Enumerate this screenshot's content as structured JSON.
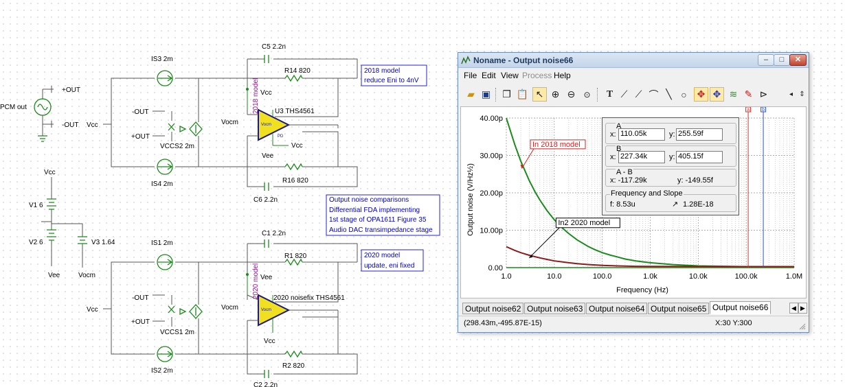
{
  "schematic": {
    "labels": {
      "pcm_out": "PCM out",
      "plus_out": "+OUT",
      "minus_out": "-OUT",
      "vcc": "Vcc",
      "vee": "Vee",
      "vocm": "Vocm",
      "v1": "V1 6",
      "v2": "V2 6",
      "v3": "V3 1.64",
      "is3": "IS3 2m",
      "is4": "IS4 2m",
      "is1": "IS1 2m",
      "is2": "IS2 2m",
      "vccs2": "VCCS2 2m",
      "vccs1": "VCCS1 2m",
      "c5": "C5 2.2n",
      "c6": "C6 2.2n",
      "c1": "C1 2.2n",
      "c2": "C2 2.2n",
      "r14": "R14 820",
      "r16": "R16 820",
      "r1": "R1 820",
      "r2": "R2 820",
      "u3": "U3 THS4561",
      "u3_vertical": "2018 model",
      "u1": "2020 noisefix THS4561",
      "u1_vertical": "2020 model",
      "amp_vocm": "Vocm",
      "amp_pd": "PD"
    },
    "note_2018": [
      "2018 model",
      "reduce Eni to 4nV"
    ],
    "note_main": [
      "Output noise comparisons",
      "Differential FDA implementing",
      "1st stage of OPA1611 Figure 35",
      "Audio DAC transimpedance stage"
    ],
    "note_2020": [
      "2020 model",
      "update, eni fixed"
    ]
  },
  "window": {
    "title": "Noname - Output noise66",
    "controls": {
      "minimize": "–",
      "maximize": "□",
      "close": "✕"
    },
    "menu": [
      {
        "label": "File",
        "disabled": false
      },
      {
        "label": "Edit",
        "disabled": false
      },
      {
        "label": "View",
        "disabled": false
      },
      {
        "label": "Process",
        "disabled": true
      },
      {
        "label": "Help",
        "disabled": false
      }
    ],
    "toolbar_icons": [
      "open-folder-icon",
      "save-icon",
      "copy-icon",
      "paste-icon",
      "pointer-icon",
      "zoom-in-icon",
      "zoom-out-icon",
      "zoom-100-icon",
      "text-tool-icon",
      "draw-icon-1",
      "draw-icon-2",
      "draw-icon-3",
      "line-tool-icon",
      "circle-tool-icon",
      "cursor-a-icon",
      "cursor-b-icon",
      "add-curve-icon",
      "marker-icon",
      "flag-icon",
      "scroll-left-icon",
      "scroll-up-down-icon"
    ],
    "cursor_panel": {
      "a_title": "A",
      "a_x_label": "x:",
      "a_x": "110.05k",
      "a_y_label": "y:",
      "a_y": "255.59f",
      "b_title": "B",
      "b_x_label": "x:",
      "b_x": "227.34k",
      "b_y_label": "y:",
      "b_y": "405.15f",
      "ab_title": "A - B",
      "ab_x": "x:  -117.29k",
      "ab_y": "y:  -149.55f",
      "freq_title": "Frequency and Slope",
      "freq_f": "f:  8.53u",
      "slope": "1.28E-18"
    },
    "tabs": [
      {
        "label": "Output noise62",
        "active": false
      },
      {
        "label": "Output noise63",
        "active": false
      },
      {
        "label": "Output noise64",
        "active": false
      },
      {
        "label": "Output noise65",
        "active": false
      },
      {
        "label": "Output noise66",
        "active": true
      }
    ],
    "status_left": "(298.43m,-495.87E-15)",
    "status_right": "X:30  Y:300"
  },
  "chart_data": {
    "type": "line",
    "title": "",
    "xlabel": "Frequency (Hz)",
    "ylabel": "Output noise (V/Hz½)",
    "x_scale": "log",
    "xlim": [
      1,
      1000000
    ],
    "ylim": [
      0,
      40
    ],
    "y_unit": "p",
    "x_ticks": [
      "1.0",
      "10.0",
      "100.0",
      "1.0k",
      "10.0k",
      "100.0k",
      "1.0M"
    ],
    "y_ticks": [
      "0.00",
      "10.00p",
      "20.00p",
      "30.00p",
      "40.00p"
    ],
    "grid": true,
    "series": [
      {
        "name": "",
        "color": "#1a8a1a",
        "x": [
          1,
          1.5,
          2,
          3,
          4,
          5,
          7,
          10,
          15,
          20,
          30,
          50,
          70,
          100,
          150,
          200,
          300,
          500,
          1000,
          3000,
          10000,
          100000,
          1000000
        ],
        "y": [
          40.0,
          32.9,
          28.5,
          23.3,
          20.2,
          18.1,
          15.3,
          12.8,
          10.5,
          9.1,
          7.4,
          5.7,
          4.8,
          4.0,
          3.3,
          2.9,
          2.3,
          1.8,
          1.3,
          0.8,
          0.45,
          0.26,
          0.26
        ]
      },
      {
        "name": "",
        "color": "#8b1a1a",
        "x": [
          1,
          1.5,
          2,
          3,
          5,
          7,
          10,
          15,
          20,
          30,
          50,
          100,
          200,
          500,
          1000,
          10000,
          100000,
          1000000
        ],
        "y": [
          5.6,
          4.6,
          4.0,
          3.3,
          2.6,
          2.2,
          1.8,
          1.5,
          1.3,
          1.05,
          0.82,
          0.6,
          0.45,
          0.35,
          0.32,
          0.3,
          0.28,
          0.28
        ]
      }
    ],
    "annotations": [
      {
        "text": "In 2018 model",
        "color": "#d62020"
      },
      {
        "text": "In2 2020 model",
        "color": "#000000"
      }
    ],
    "cursors": [
      {
        "label": "a",
        "x": 110050,
        "color": "#e03030"
      },
      {
        "label": "b",
        "x": 227340,
        "color": "#3050d0"
      }
    ]
  }
}
